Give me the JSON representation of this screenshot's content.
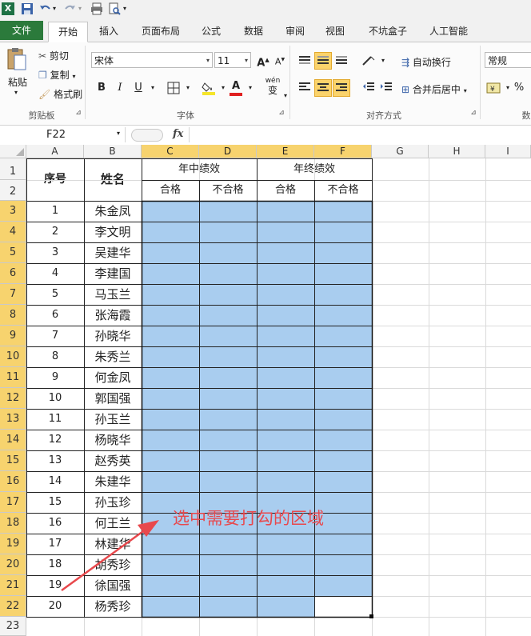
{
  "ribbon_tabs": [
    "文件",
    "开始",
    "插入",
    "页面布局",
    "公式",
    "数据",
    "审阅",
    "视图",
    "不坑盒子",
    "人工智能"
  ],
  "clipboard": {
    "paste": "粘贴",
    "cut": "剪切",
    "copy": "复制",
    "format_painter": "格式刷",
    "group": "剪贴板"
  },
  "font": {
    "name": "宋体",
    "size": "11",
    "group": "字体",
    "bold": "B",
    "italic": "I",
    "underline": "U",
    "wen": "wén",
    "wen_char": "变"
  },
  "alignment": {
    "wrap": "自动换行",
    "merge": "合并后居中",
    "group": "对齐方式"
  },
  "number": {
    "format": "常规",
    "percent": "%",
    "comma": ",",
    "group": "数"
  },
  "formula_bar": {
    "name_box": "F22",
    "fx": "fx",
    "value": ""
  },
  "columns": [
    "A",
    "B",
    "C",
    "D",
    "E",
    "F",
    "G",
    "H",
    "I"
  ],
  "rows": [
    "1",
    "2",
    "3",
    "4",
    "5",
    "6",
    "7",
    "8",
    "9",
    "10",
    "11",
    "12",
    "13",
    "14",
    "15",
    "16",
    "17",
    "18",
    "19",
    "20",
    "21",
    "22",
    "23"
  ],
  "table": {
    "header_seq": "序号",
    "header_name": "姓名",
    "mid_year": "年中绩效",
    "year_end": "年终绩效",
    "pass": "合格",
    "fail": "不合格",
    "records": [
      {
        "no": "1",
        "name": "朱金凤"
      },
      {
        "no": "2",
        "name": "李文明"
      },
      {
        "no": "3",
        "name": "吴建华"
      },
      {
        "no": "4",
        "name": "李建国"
      },
      {
        "no": "5",
        "name": "马玉兰"
      },
      {
        "no": "6",
        "name": "张海霞"
      },
      {
        "no": "7",
        "name": "孙晓华"
      },
      {
        "no": "8",
        "name": "朱秀兰"
      },
      {
        "no": "9",
        "name": "何金凤"
      },
      {
        "no": "10",
        "name": "郭国强"
      },
      {
        "no": "11",
        "name": "孙玉兰"
      },
      {
        "no": "12",
        "name": "杨晓华"
      },
      {
        "no": "13",
        "name": "赵秀英"
      },
      {
        "no": "14",
        "name": "朱建华"
      },
      {
        "no": "15",
        "name": "孙玉珍"
      },
      {
        "no": "16",
        "name": "何王兰"
      },
      {
        "no": "17",
        "name": "林建华"
      },
      {
        "no": "18",
        "name": "胡秀珍"
      },
      {
        "no": "19",
        "name": "徐国强"
      },
      {
        "no": "20",
        "name": "杨秀珍"
      }
    ]
  },
  "annotation": {
    "text": "选中需要打勾的区域",
    "color": "#e8484c"
  },
  "colors": {
    "selection": "#a9cdef",
    "file_tab": "#2b7a3b",
    "header_sel": "#f7d36e"
  }
}
